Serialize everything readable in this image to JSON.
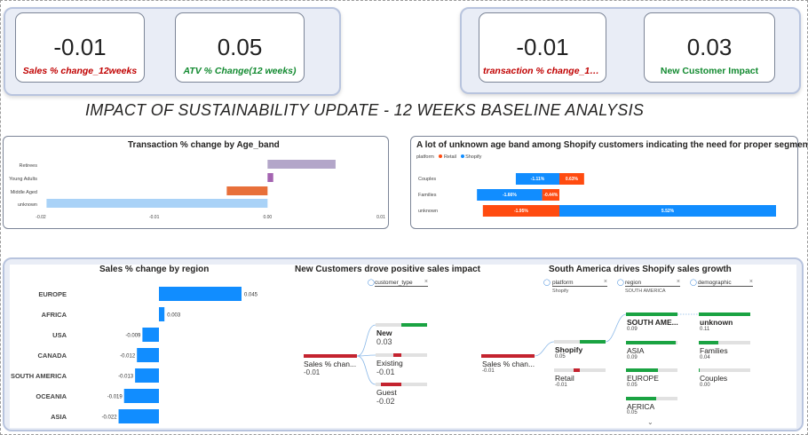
{
  "kpis": {
    "sales_change": {
      "value": "-0.01",
      "label": "Sales % change_12weeks"
    },
    "atv_change": {
      "value": "0.05",
      "label": "ATV % Change(12 weeks)"
    },
    "transaction_change": {
      "value": "-0.01",
      "label": "transaction % change_12w..."
    },
    "new_customer": {
      "value": "0.03",
      "label": "New Customer Impact"
    }
  },
  "page_title": "IMPACT OF SUSTAINABILITY UPDATE - 12 WEEKS BASELINE ANALYSIS",
  "colors": {
    "retail": "#ff4b10",
    "shopify": "#118dff",
    "red_node": "#c4232f",
    "green_node": "#1aa342",
    "region_bar": "#118dff"
  },
  "chart_data": [
    {
      "type": "bar",
      "title": "Transaction % change by Age_band",
      "orientation": "horizontal",
      "categories": [
        "Retirees",
        "Young Adults",
        "Middle Aged",
        "unknown"
      ],
      "values": [
        0.006,
        0.0005,
        -0.0036,
        -0.0195
      ],
      "bar_colors": [
        "#b3a6c9",
        "#a464b1",
        "#e8703a",
        "#a9d2f7"
      ],
      "xlim": [
        -0.02,
        0.01
      ],
      "x_ticks": [
        "-0.02",
        "-0.01",
        "0.00",
        "0.01"
      ]
    },
    {
      "type": "bar",
      "title": "A lot of unknown age band among Shopify customers indicating the need for proper segmentation",
      "orientation": "horizontal-stacked",
      "legend_title": "platform",
      "legend": [
        "Retail",
        "Shopify"
      ],
      "categories": [
        "Couples",
        "Families",
        "unknown"
      ],
      "series": [
        {
          "name": "Retail",
          "values": [
            0.0063,
            -0.0044,
            -0.0195
          ],
          "labels": [
            "0.63%",
            "-0.44%",
            "-1.95%"
          ]
        },
        {
          "name": "Shopify",
          "values": [
            -0.0111,
            -0.0166,
            0.0552
          ],
          "labels": [
            "-1.11%",
            "-1.66%",
            "5.52%"
          ]
        }
      ]
    },
    {
      "type": "bar",
      "title": "Sales % change by region",
      "orientation": "horizontal",
      "categories": [
        "EUROPE",
        "AFRICA",
        "USA",
        "CANADA",
        "SOUTH AMERICA",
        "OCEANIA",
        "ASIA"
      ],
      "values": [
        0.045,
        0.003,
        -0.009,
        -0.012,
        -0.013,
        -0.019,
        -0.022
      ],
      "labels": [
        "0.045",
        "0.003",
        "-0.009",
        "-0.012",
        "-0.013",
        "-0.019",
        "-0.022"
      ]
    }
  ],
  "tree1": {
    "title": "New Customers drove positive sales impact",
    "filter": "customer_type",
    "root": {
      "label": "Sales % chan...",
      "value": "-0.01"
    },
    "children": [
      {
        "label": "New",
        "value": "0.03",
        "bold": true,
        "pos": 0.2
      },
      {
        "label": "Existing",
        "value": "-0.01",
        "pos": 0.6
      },
      {
        "label": "Guest",
        "value": "-0.02",
        "pos": 0.5
      }
    ]
  },
  "tree2": {
    "title": "South America drives Shopify sales growth",
    "filters": [
      {
        "label": "platform",
        "sub": "Shopify"
      },
      {
        "label": "region",
        "sub": "SOUTH AMERICA"
      },
      {
        "label": "demographic",
        "sub": ""
      }
    ],
    "root": {
      "label": "Sales % chan...",
      "value": "-0.01"
    },
    "platform": [
      {
        "label": "Shopify",
        "value": "0.05",
        "bold": true
      },
      {
        "label": "Retail",
        "value": "-0.01"
      }
    ],
    "region": [
      {
        "label": "SOUTH AME...",
        "value": "0.09",
        "bold": true
      },
      {
        "label": "ASIA",
        "value": "0.09"
      },
      {
        "label": "EUROPE",
        "value": "0.05"
      },
      {
        "label": "AFRICA",
        "value": "0.05"
      }
    ],
    "demographic": [
      {
        "label": "unknown",
        "value": "0.11",
        "bold": true
      },
      {
        "label": "Families",
        "value": "0.04"
      },
      {
        "label": "Couples",
        "value": "0.00"
      }
    ]
  }
}
